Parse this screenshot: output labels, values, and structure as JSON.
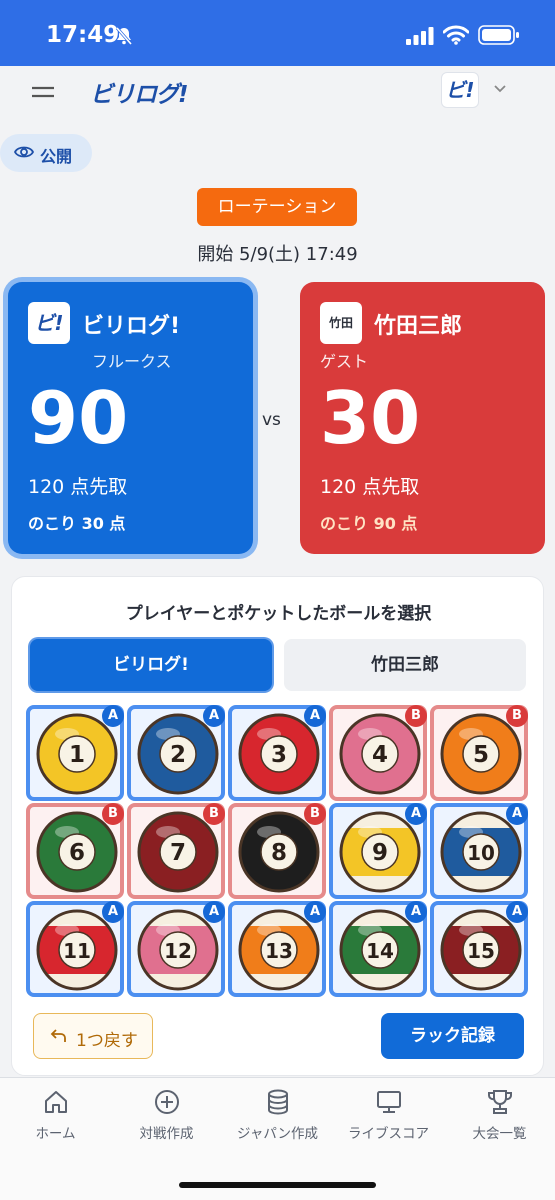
{
  "status_bar": {
    "time": "17:49"
  },
  "app": {
    "brand": "ビリログ!",
    "logo_text": "ビ!"
  },
  "visibility": {
    "label": "公開"
  },
  "match": {
    "mode": "ローテーション",
    "start": "開始 5/9(土) 17:49",
    "vs": "vs"
  },
  "players": [
    {
      "avatar": "ビ!",
      "name": "ビリログ!",
      "sub": "フルークス",
      "score": "90",
      "race": "120 点先取",
      "remaining": "のこり 30 点"
    },
    {
      "avatar": "竹田",
      "name": "竹田三郎",
      "sub": "ゲスト",
      "score": "30",
      "race": "120 点先取",
      "remaining": "のこり 90 点"
    }
  ],
  "panel": {
    "title": "プレイヤーとポケットしたボールを選択",
    "tabs": [
      "ビリログ!",
      "竹田三郎"
    ],
    "undo_label": "1つ戻す",
    "rack_label": "ラック記録"
  },
  "balls": [
    {
      "number": "1",
      "color": "#f3c526",
      "stripe": false,
      "owner": "A"
    },
    {
      "number": "2",
      "color": "#1f5b9e",
      "stripe": false,
      "owner": "A"
    },
    {
      "number": "3",
      "color": "#d7262e",
      "stripe": false,
      "owner": "A"
    },
    {
      "number": "4",
      "color": "#e0708f",
      "stripe": false,
      "owner": "B"
    },
    {
      "number": "5",
      "color": "#f07d1a",
      "stripe": false,
      "owner": "B"
    },
    {
      "number": "6",
      "color": "#2a7a3a",
      "stripe": false,
      "owner": "B"
    },
    {
      "number": "7",
      "color": "#8a1f22",
      "stripe": false,
      "owner": "B"
    },
    {
      "number": "8",
      "color": "#1e1e1e",
      "stripe": false,
      "owner": "B"
    },
    {
      "number": "9",
      "color": "#f3c526",
      "stripe": true,
      "owner": "A"
    },
    {
      "number": "10",
      "color": "#1f5b9e",
      "stripe": true,
      "owner": "A"
    },
    {
      "number": "11",
      "color": "#d7262e",
      "stripe": true,
      "owner": "A"
    },
    {
      "number": "12",
      "color": "#e0708f",
      "stripe": true,
      "owner": "A"
    },
    {
      "number": "13",
      "color": "#f07d1a",
      "stripe": true,
      "owner": "A"
    },
    {
      "number": "14",
      "color": "#2a7a3a",
      "stripe": true,
      "owner": "A"
    },
    {
      "number": "15",
      "color": "#8a1f22",
      "stripe": true,
      "owner": "A"
    }
  ],
  "bottom_nav": [
    {
      "label": "ホーム",
      "icon": "home-icon"
    },
    {
      "label": "対戦作成",
      "icon": "plus-circle-icon"
    },
    {
      "label": "ジャパン作成",
      "icon": "database-icon"
    },
    {
      "label": "ライブスコア",
      "icon": "monitor-icon"
    },
    {
      "label": "大会一覧",
      "icon": "trophy-icon"
    }
  ],
  "colors": {
    "primary": "#116bd8",
    "opponent": "#d93b3b",
    "accent": "#f56a0f",
    "status_bar": "#2f6ee6"
  }
}
